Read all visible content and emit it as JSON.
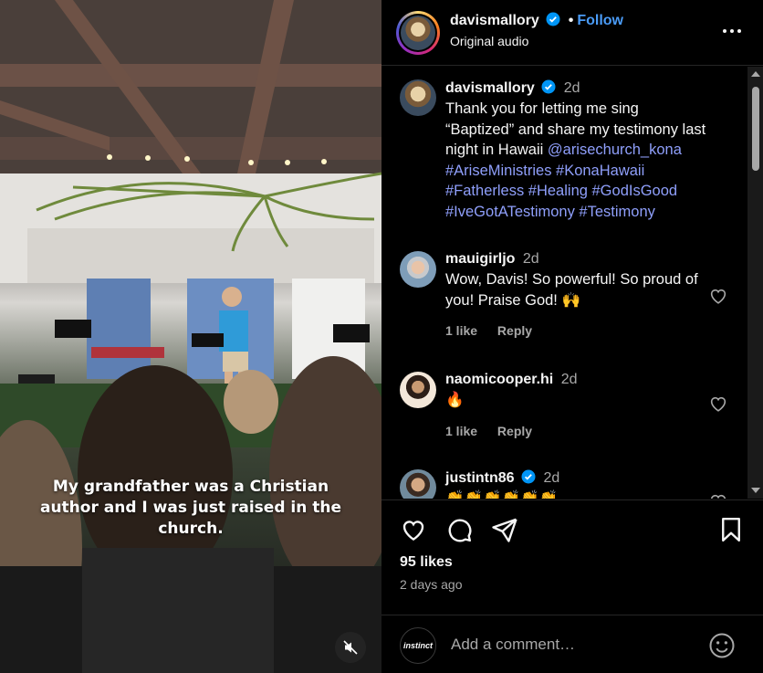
{
  "video": {
    "caption": "My grandfather was a Christian author and I was just raised in the church."
  },
  "header": {
    "username": "davismallory",
    "dot": "•",
    "follow_label": "Follow",
    "audio_label": "Original audio"
  },
  "post": {
    "username": "davismallory",
    "time": "2d",
    "caption_text": "Thank you for letting me sing “Baptized” and share my testimony last night in Hawaii ",
    "mention": "@arisechurch_kona",
    "hashtags": "#AriseMinistries #KonaHawaii #Fatherless #Healing #GodIsGood #IveGotATestimony #Testimony"
  },
  "comments": [
    {
      "username": "mauigirljo",
      "time": "2d",
      "text": "Wow, Davis! So powerful! So proud of you! Praise God! 🙌",
      "likes": "1 like",
      "reply": "Reply"
    },
    {
      "username": "naomicooper.hi",
      "time": "2d",
      "text": "🔥",
      "likes": "1 like",
      "reply": "Reply"
    },
    {
      "username": "justintn86",
      "time": "2d",
      "text": "👏👏👏👏👏👏",
      "verified": true
    }
  ],
  "stats": {
    "likes": "95 likes",
    "ago": "2 days ago"
  },
  "composer": {
    "avatar_text": "instinct",
    "placeholder": "Add a comment…"
  },
  "icons": {
    "like": "heart-icon",
    "comment": "comment-icon",
    "share": "send-icon",
    "save": "bookmark-icon",
    "more": "more-horizontal-icon",
    "mute": "muted-speaker-icon",
    "emoji": "emoji-icon"
  },
  "colors": {
    "link": "#4a9bf6",
    "hashtag": "#8f9ffb",
    "verified": "#0095f6",
    "muted_text": "#a8a8a8"
  }
}
